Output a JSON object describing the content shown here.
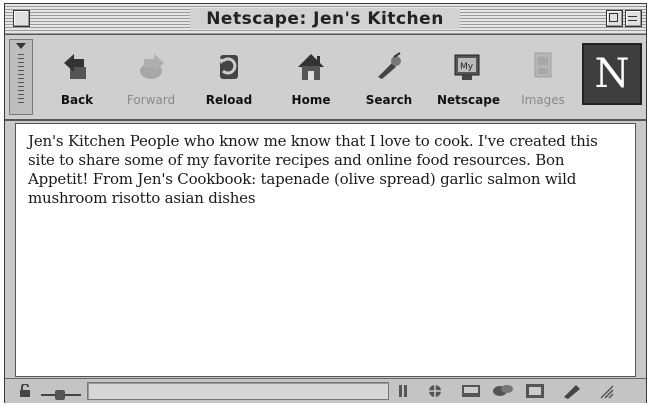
{
  "window": {
    "title": "Netscape: Jen's Kitchen"
  },
  "toolbar": {
    "buttons": [
      {
        "label": "Back",
        "icon": "back-icon",
        "enabled": true
      },
      {
        "label": "Forward",
        "icon": "forward-icon",
        "enabled": false
      },
      {
        "label": "Reload",
        "icon": "reload-icon",
        "enabled": true
      },
      {
        "label": "Home",
        "icon": "home-icon",
        "enabled": true
      },
      {
        "label": "Search",
        "icon": "search-icon",
        "enabled": true
      },
      {
        "label": "Netscape",
        "icon": "netscape-icon",
        "enabled": true
      },
      {
        "label": "Images",
        "icon": "images-icon",
        "enabled": false
      }
    ],
    "logo_letter": "N"
  },
  "page": {
    "body_text": "Jen's Kitchen People who know me know that I love to cook. I've created this site to share some of my favorite recipes and online food resources. Bon Appetit! From Jen's Cookbook: tapenade (olive spread) garlic salmon wild mushroom risotto asian dishes"
  },
  "status": {
    "text": ""
  },
  "colors": {
    "chrome": "#c9c9c9",
    "logo_bg": "#3e3e3e",
    "content_bg": "#ffffff"
  }
}
